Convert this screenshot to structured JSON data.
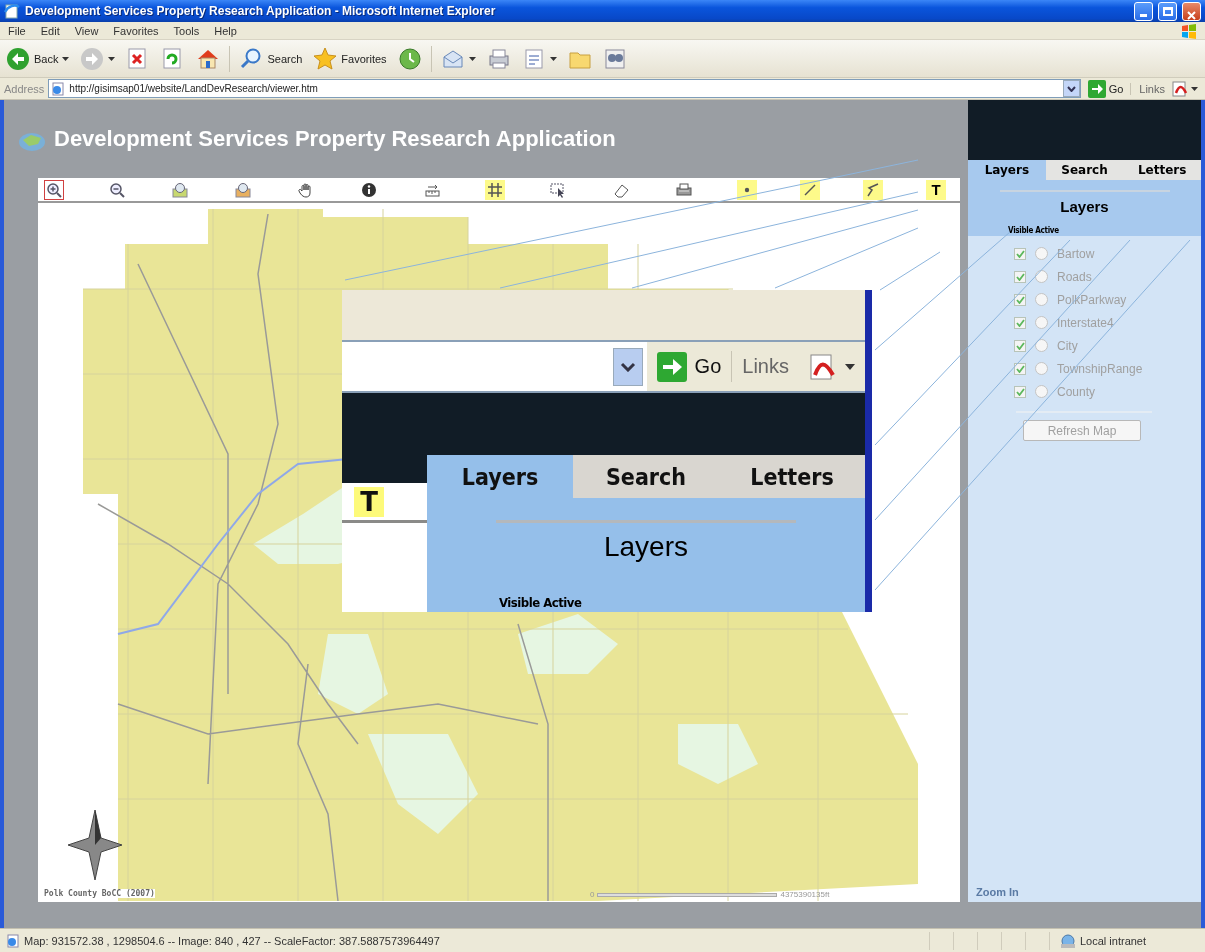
{
  "window": {
    "title": "Development Services Property Research Application - Microsoft Internet Explorer"
  },
  "menu": [
    "File",
    "Edit",
    "View",
    "Favorites",
    "Tools",
    "Help"
  ],
  "ie_toolbar": [
    {
      "kind": "back",
      "label": "Back"
    },
    {
      "kind": "forward"
    },
    {
      "kind": "stop"
    },
    {
      "kind": "refresh"
    },
    {
      "kind": "home"
    },
    {
      "kind": "search",
      "label": "Search"
    },
    {
      "kind": "favorites",
      "label": "Favorites"
    },
    {
      "kind": "history"
    },
    {
      "kind": "mail"
    },
    {
      "kind": "print"
    },
    {
      "kind": "edit"
    },
    {
      "kind": "folder"
    },
    {
      "kind": "research"
    }
  ],
  "address_bar": {
    "label": "Address",
    "value": "http://gisimsap01/website/LandDevResearch/viewer.htm",
    "go": "Go",
    "links": "Links"
  },
  "app": {
    "title": "Development Services Property Research Application",
    "tools": [
      {
        "kind": "zoom-in",
        "selected": true,
        "highlighted": false
      },
      {
        "kind": "zoom-out",
        "selected": false,
        "highlighted": false
      },
      {
        "kind": "full-extent",
        "selected": false,
        "highlighted": false
      },
      {
        "kind": "previous-extent",
        "selected": false,
        "highlighted": false
      },
      {
        "kind": "pan",
        "selected": false,
        "highlighted": false
      },
      {
        "kind": "identify",
        "selected": false,
        "highlighted": false
      },
      {
        "kind": "measure",
        "selected": false,
        "highlighted": false
      },
      {
        "kind": "grid",
        "selected": false,
        "highlighted": true
      },
      {
        "kind": "select",
        "selected": false,
        "highlighted": false
      },
      {
        "kind": "clear",
        "selected": false,
        "highlighted": false
      },
      {
        "kind": "print",
        "selected": false,
        "highlighted": false
      },
      {
        "kind": "point",
        "selected": false,
        "highlighted": true
      },
      {
        "kind": "line",
        "selected": false,
        "highlighted": true
      },
      {
        "kind": "polyline",
        "selected": false,
        "highlighted": true
      },
      {
        "kind": "text",
        "label": "T",
        "selected": false,
        "highlighted": true
      }
    ],
    "map": {
      "kind": "picture",
      "credit": "Polk County BoCC (2007)",
      "scale_start": "0",
      "scale_end": "4375390135ft"
    }
  },
  "panel": {
    "tabs": [
      {
        "label": "Layers",
        "selected": true
      },
      {
        "label": "Search",
        "selected": false
      },
      {
        "label": "Letters",
        "selected": false
      }
    ],
    "heading": "Layers",
    "columns_caption": "Visible Active",
    "layers": [
      {
        "name": "Bartow",
        "visible": true,
        "active": false,
        "disabled": true
      },
      {
        "name": "Roads",
        "visible": true,
        "active": false,
        "disabled": true
      },
      {
        "name": "PolkParkway",
        "visible": true,
        "active": false,
        "disabled": true
      },
      {
        "name": "Interstate4",
        "visible": true,
        "active": false,
        "disabled": true
      },
      {
        "name": "City",
        "visible": true,
        "active": false,
        "disabled": true
      },
      {
        "name": "TownshipRange",
        "visible": true,
        "active": false,
        "disabled": true
      },
      {
        "name": "County",
        "visible": true,
        "active": false,
        "disabled": true
      }
    ],
    "refresh_button": {
      "label": "Refresh Map",
      "disabled": true
    },
    "status": "Zoom In"
  },
  "magnifier_inset": {
    "go": "Go",
    "links": "Links",
    "tabs": [
      {
        "label": "Layers",
        "selected": true
      },
      {
        "label": "Search",
        "selected": false
      },
      {
        "label": "Letters",
        "selected": false
      }
    ],
    "tool": "T",
    "heading": "Layers",
    "columns_caption": "Visible Active"
  },
  "status_bar": {
    "text": "Map: 931572.38 , 1298504.6 -- Image: 840 , 427 -- ScaleFactor: 387.5887573964497",
    "zone": "Local intranet"
  }
}
